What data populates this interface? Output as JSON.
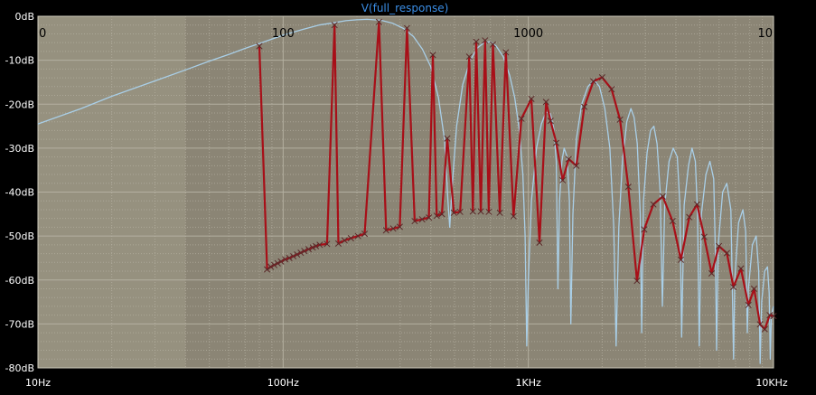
{
  "window": {
    "trace_title": "V(full_response)"
  },
  "colors": {
    "background": "#000000",
    "plot_bg": "#8b8575",
    "plot_bg_left": "#96917f",
    "grid": "#b6b2a3",
    "trace_light": "#a9cfe8",
    "trace_red": "#a80f18",
    "marker": "#5a2a2a",
    "title": "#3b8ee6"
  },
  "chart_data": {
    "type": "line",
    "title": "V(full_response)",
    "xscale": "log",
    "xlim": [
      10,
      10000
    ],
    "ylim": [
      -80,
      0
    ],
    "grid": true,
    "x_tick_labels": [
      "10Hz",
      "100Hz",
      "1KHz",
      "10KHz"
    ],
    "x_tick_values": [
      10,
      100,
      1000,
      10000
    ],
    "top_tick_labels": [
      "0",
      "100",
      "1000",
      "10"
    ],
    "y_tick_labels": [
      "0dB",
      "-10dB",
      "-20dB",
      "-30dB",
      "-40dB",
      "-50dB",
      "-60dB",
      "-70dB",
      "-80dB"
    ],
    "y_tick_values": [
      0,
      -10,
      -20,
      -30,
      -40,
      -50,
      -60,
      -70,
      -80
    ],
    "series": [
      {
        "id": "full_response",
        "color": "#a9cfe8",
        "points": [
          [
            10,
            -24.5
          ],
          [
            15,
            -21
          ],
          [
            20,
            -18.2
          ],
          [
            30,
            -14.7
          ],
          [
            40,
            -12.2
          ],
          [
            50,
            -10.2
          ],
          [
            60,
            -8.7
          ],
          [
            70,
            -7.3
          ],
          [
            80,
            -6.2
          ],
          [
            90,
            -5.2
          ],
          [
            100,
            -4.3
          ],
          [
            120,
            -3.0
          ],
          [
            140,
            -2.0
          ],
          [
            160,
            -1.5
          ],
          [
            180,
            -1.0
          ],
          [
            200,
            -0.8
          ],
          [
            220,
            -0.7
          ],
          [
            250,
            -0.9
          ],
          [
            280,
            -1.6
          ],
          [
            310,
            -2.8
          ],
          [
            340,
            -4.6
          ],
          [
            370,
            -7.5
          ],
          [
            400,
            -11.5
          ],
          [
            430,
            -18.5
          ],
          [
            455,
            -28
          ],
          [
            470,
            -42
          ],
          [
            478,
            -48
          ],
          [
            490,
            -38
          ],
          [
            510,
            -25
          ],
          [
            540,
            -15.5
          ],
          [
            580,
            -10
          ],
          [
            620,
            -7.2
          ],
          [
            660,
            -6.0
          ],
          [
            700,
            -5.8
          ],
          [
            740,
            -6.8
          ],
          [
            790,
            -9.2
          ],
          [
            840,
            -13.5
          ],
          [
            880,
            -18.5
          ],
          [
            920,
            -26
          ],
          [
            950,
            -36
          ],
          [
            970,
            -50
          ],
          [
            985,
            -75
          ],
          [
            1000,
            -60
          ],
          [
            1030,
            -42
          ],
          [
            1080,
            -30
          ],
          [
            1130,
            -24.5
          ],
          [
            1180,
            -21.8
          ],
          [
            1230,
            -22.2
          ],
          [
            1270,
            -25.5
          ],
          [
            1300,
            -33
          ],
          [
            1320,
            -62
          ],
          [
            1340,
            -42
          ],
          [
            1370,
            -33
          ],
          [
            1400,
            -30
          ],
          [
            1440,
            -32
          ],
          [
            1470,
            -42
          ],
          [
            1490,
            -70
          ],
          [
            1520,
            -45
          ],
          [
            1570,
            -28
          ],
          [
            1650,
            -20
          ],
          [
            1750,
            -16
          ],
          [
            1850,
            -14.5
          ],
          [
            1950,
            -16
          ],
          [
            2050,
            -21
          ],
          [
            2150,
            -30
          ],
          [
            2230,
            -48
          ],
          [
            2280,
            -75
          ],
          [
            2340,
            -48
          ],
          [
            2420,
            -33
          ],
          [
            2520,
            -24
          ],
          [
            2620,
            -21
          ],
          [
            2700,
            -23
          ],
          [
            2780,
            -29
          ],
          [
            2860,
            -45
          ],
          [
            2900,
            -72
          ],
          [
            2950,
            -42
          ],
          [
            3050,
            -31
          ],
          [
            3150,
            -26
          ],
          [
            3250,
            -25
          ],
          [
            3350,
            -29
          ],
          [
            3450,
            -40
          ],
          [
            3520,
            -66
          ],
          [
            3600,
            -43
          ],
          [
            3750,
            -33
          ],
          [
            3900,
            -30
          ],
          [
            4050,
            -32
          ],
          [
            4150,
            -43
          ],
          [
            4220,
            -73
          ],
          [
            4320,
            -43
          ],
          [
            4500,
            -34
          ],
          [
            4650,
            -30
          ],
          [
            4800,
            -33
          ],
          [
            4900,
            -45
          ],
          [
            4980,
            -75
          ],
          [
            5080,
            -45
          ],
          [
            5300,
            -36
          ],
          [
            5500,
            -33
          ],
          [
            5700,
            -37
          ],
          [
            5800,
            -55
          ],
          [
            5860,
            -76
          ],
          [
            5950,
            -52
          ],
          [
            6200,
            -40
          ],
          [
            6450,
            -38
          ],
          [
            6700,
            -44
          ],
          [
            6800,
            -64
          ],
          [
            6870,
            -78
          ],
          [
            6950,
            -60
          ],
          [
            7200,
            -47
          ],
          [
            7500,
            -44
          ],
          [
            7700,
            -49
          ],
          [
            7820,
            -72
          ],
          [
            7900,
            -62
          ],
          [
            8200,
            -52
          ],
          [
            8500,
            -50
          ],
          [
            8700,
            -58
          ],
          [
            8820,
            -79
          ],
          [
            8950,
            -65
          ],
          [
            9200,
            -58
          ],
          [
            9450,
            -57
          ],
          [
            9600,
            -63
          ],
          [
            9700,
            -78
          ],
          [
            9800,
            -68
          ],
          [
            10000,
            -66
          ]
        ]
      },
      {
        "id": "sampled_response",
        "color": "#a80f18",
        "points": [
          [
            80,
            -6.8
          ],
          [
            86,
            -57.6
          ],
          [
            89,
            -57
          ],
          [
            92,
            -56.6
          ],
          [
            95,
            -56.2
          ],
          [
            98,
            -55.8
          ],
          [
            102,
            -55.3
          ],
          [
            106,
            -55
          ],
          [
            110,
            -54.6
          ],
          [
            114,
            -54.2
          ],
          [
            118,
            -53.8
          ],
          [
            122,
            -53.4
          ],
          [
            127,
            -53
          ],
          [
            132,
            -52.6
          ],
          [
            136,
            -52.3
          ],
          [
            141,
            -52
          ],
          [
            151,
            -51.8
          ],
          [
            162,
            -2.0
          ],
          [
            168,
            -51.7
          ],
          [
            178,
            -51
          ],
          [
            189,
            -50.5
          ],
          [
            202,
            -50
          ],
          [
            215,
            -49.5
          ],
          [
            246,
            -1.3
          ],
          [
            263,
            -48.7
          ],
          [
            281,
            -48.3
          ],
          [
            299,
            -47.9
          ],
          [
            320,
            -2.7
          ],
          [
            344,
            -46.6
          ],
          [
            369,
            -46.2
          ],
          [
            393,
            -45.8
          ],
          [
            408,
            -8.8
          ],
          [
            423,
            -45.4
          ],
          [
            444,
            -45
          ],
          [
            467,
            -27.8
          ],
          [
            497,
            -44.7
          ],
          [
            527,
            -44.5
          ],
          [
            574,
            -9.2
          ],
          [
            594,
            -44.4
          ],
          [
            613,
            -5.8
          ],
          [
            640,
            -44.4
          ],
          [
            666,
            -5.5
          ],
          [
            690,
            -44.5
          ],
          [
            717,
            -6.4
          ],
          [
            765,
            -44.7
          ],
          [
            810,
            -8.2
          ],
          [
            870,
            -45.5
          ],
          [
            937,
            -23.3
          ],
          [
            1029,
            -18.8
          ],
          [
            1110,
            -51.5
          ],
          [
            1181,
            -19.5
          ],
          [
            1232,
            -23.8
          ],
          [
            1300,
            -28.8
          ],
          [
            1380,
            -37.3
          ],
          [
            1460,
            -32.5
          ],
          [
            1570,
            -34
          ],
          [
            1692,
            -20.6
          ],
          [
            1842,
            -14.8
          ],
          [
            2000,
            -13.9
          ],
          [
            2186,
            -16.6
          ],
          [
            2366,
            -23.5
          ],
          [
            2558,
            -38.8
          ],
          [
            2774,
            -60.2
          ],
          [
            2969,
            -48.5
          ],
          [
            3235,
            -42.8
          ],
          [
            3533,
            -41.0
          ],
          [
            3876,
            -46.6
          ],
          [
            4189,
            -55.4
          ],
          [
            4535,
            -45.7
          ],
          [
            4879,
            -42.8
          ],
          [
            5215,
            -50.2
          ],
          [
            5592,
            -58.5
          ],
          [
            5989,
            -52.3
          ],
          [
            6454,
            -53.9
          ],
          [
            6862,
            -61.6
          ],
          [
            7364,
            -57.4
          ],
          [
            7900,
            -65.7
          ],
          [
            8330,
            -62.0
          ],
          [
            8811,
            -70.1
          ],
          [
            9212,
            -71.2
          ],
          [
            9650,
            -68.0
          ],
          [
            10000,
            -68.2
          ]
        ]
      }
    ]
  }
}
